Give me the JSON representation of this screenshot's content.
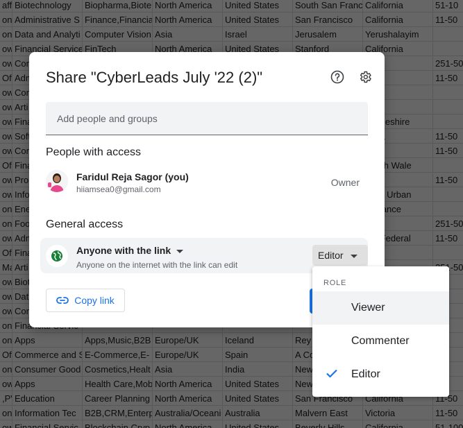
{
  "sheet": {
    "rows": [
      [
        "affi",
        "Biotechnology",
        "Biopharma,Biote",
        "North America",
        "United States",
        "South San Franc",
        "California",
        "51-10"
      ],
      [
        "on",
        "Administrative S",
        "Finance,Financia",
        "North America",
        "United States",
        "San Francisco",
        "California",
        "11-50"
      ],
      [
        "on",
        "Data and Analyti",
        "Computer Vision",
        "Asia",
        "Israel",
        "Jerusalem",
        "Yerushalayim",
        ""
      ],
      [
        "ow",
        "Financial Service",
        "FinTech",
        "North America",
        "United States",
        "Stanford",
        "California",
        ""
      ],
      [
        "ow",
        "Con",
        "",
        "",
        "",
        "",
        "York",
        "251-50"
      ],
      [
        "Of",
        "Adm",
        "",
        "",
        "",
        "",
        "ba",
        "11-50"
      ],
      [
        "ow",
        "Con",
        "",
        "",
        "",
        "",
        "Aviv",
        ""
      ],
      [
        "ow",
        "Arti",
        "",
        "",
        "",
        "",
        "and",
        ""
      ],
      [
        "ow",
        "Fina",
        "",
        "",
        "",
        "",
        "bridgeshire",
        ""
      ],
      [
        "ow",
        "Soft",
        "",
        "",
        "",
        "",
        "ornia",
        "11-50"
      ],
      [
        "ow",
        "Con",
        "",
        "",
        "",
        "",
        "iyad",
        "11-50"
      ],
      [
        "Of",
        "Fina",
        "",
        "",
        "",
        "",
        "South Wale",
        ""
      ],
      [
        "ow",
        "Pro",
        "",
        "",
        "",
        "",
        "and",
        "11-50"
      ],
      [
        "ow",
        "Info",
        "",
        "",
        "",
        "",
        "ijana Urban",
        ""
      ],
      [
        "on",
        "Ene",
        "",
        "",
        "",
        "",
        "e-France",
        ""
      ],
      [
        "on",
        "Foo",
        "",
        "",
        "",
        "",
        "souri",
        "251-50"
      ],
      [
        "ow",
        "Adm",
        "",
        "",
        "",
        "",
        "rito Federal",
        "11-50"
      ],
      [
        "Of",
        "Fina",
        "",
        "",
        "",
        "",
        "and",
        ""
      ],
      [
        "Ma",
        "Arti",
        "",
        "",
        "",
        "",
        "",
        "251-50"
      ],
      [
        "ow",
        "Biot",
        "",
        "",
        "",
        "",
        "",
        ""
      ],
      [
        "ow",
        "Dat",
        "",
        "",
        "",
        "",
        "",
        ""
      ],
      [
        "ow",
        "Con",
        "",
        "",
        "",
        "",
        "",
        ""
      ],
      [
        "on",
        "Financial Servic",
        "",
        "",
        "",
        "",
        "",
        "50"
      ],
      [
        "on",
        "Apps",
        "Apps,Music,B2B",
        "Europe/UK",
        "Iceland",
        "Rey",
        "",
        ""
      ],
      [
        "Of",
        "Commerce and S",
        "E-Commerce,E-",
        "Europe/UK",
        "Spain",
        "A Co",
        "",
        "50"
      ],
      [
        "on",
        "Consumer Good",
        "Cosmetics,Healt",
        "Asia",
        "India",
        "New",
        "",
        "50"
      ],
      [
        "ow",
        "Apps",
        "Health Care,Mob",
        "North America",
        "United States",
        "New",
        "",
        "-25"
      ],
      [
        ",PV",
        "Education",
        "Career Planning",
        "North America",
        "United States",
        "San Francisco",
        "California",
        "11-50"
      ],
      [
        "on",
        "Information Tec",
        "B2B,CRM,Enterp",
        "Australia/Oceani",
        "Australia",
        "Malvern East",
        "Victoria",
        "11-50"
      ],
      [
        "ow",
        "Financial Servic",
        "Blockchain,Cryp",
        "North America",
        "United States",
        "Beverly Hills",
        "California",
        "51-100"
      ]
    ]
  },
  "dialog": {
    "title": "Share \"CyberLeads July '22 (2)\"",
    "add_people_placeholder": "Add people and groups",
    "people_with_access_title": "People with access",
    "person": {
      "name": "Faridul Reja Sagor (you)",
      "email": "hiiamsea0@gmail.com",
      "role": "Owner"
    },
    "general_access_title": "General access",
    "access": {
      "label": "Anyone with the link",
      "description": "Anyone on the internet with the link can edit",
      "role_button": "Editor"
    },
    "copy_link_label": "Copy link"
  },
  "role_menu": {
    "header": "ROLE",
    "items": [
      {
        "label": "Viewer",
        "selected": false
      },
      {
        "label": "Commenter",
        "selected": false
      },
      {
        "label": "Editor",
        "selected": true
      }
    ]
  },
  "colors": {
    "accent": "#1a73e8",
    "globe": "#188038"
  }
}
